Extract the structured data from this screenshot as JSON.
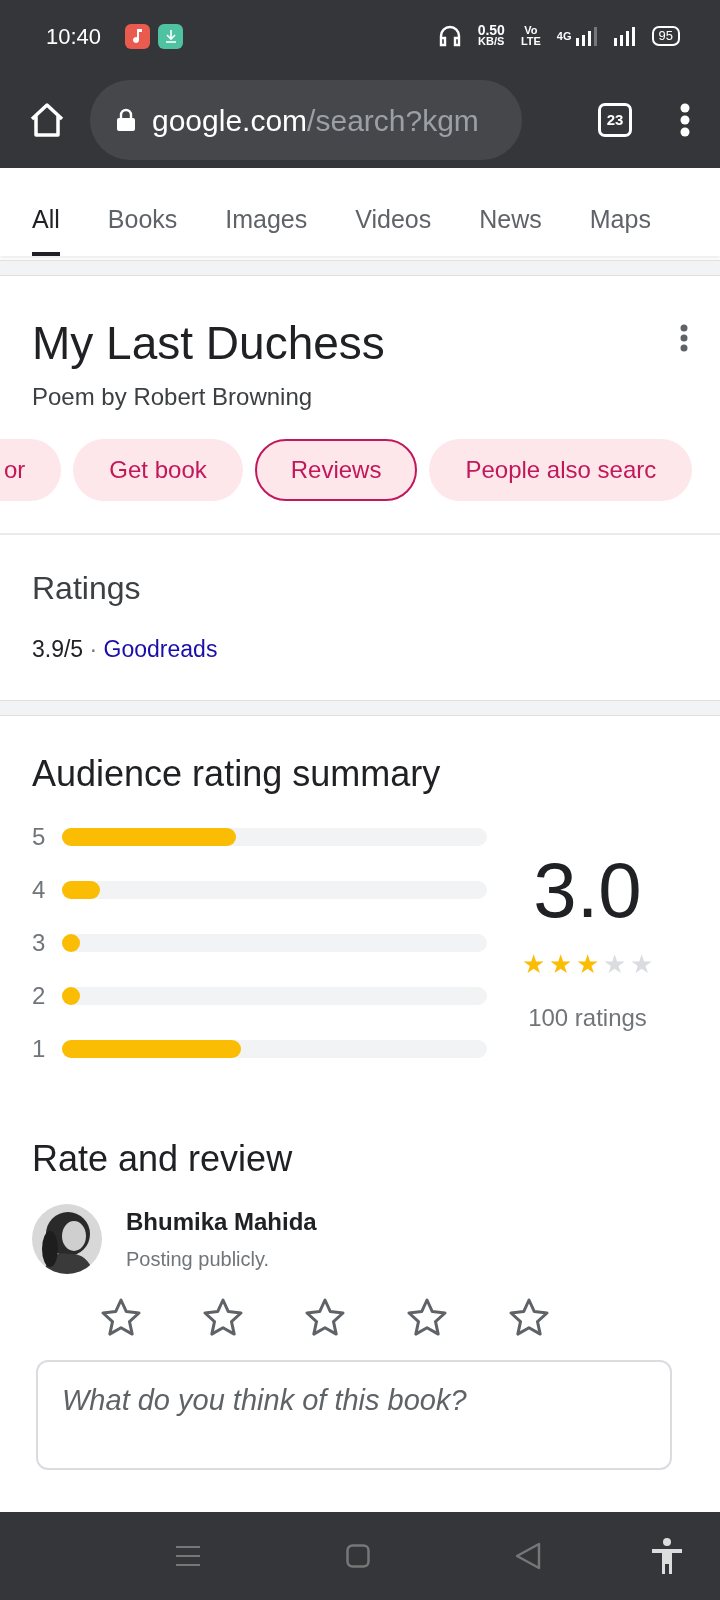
{
  "status_bar": {
    "time": "10:40",
    "speed_value": "0.50",
    "speed_unit": "KB/S",
    "volte_top": "Vo",
    "volte_bottom": "LTE",
    "network": "4G",
    "battery": "95"
  },
  "browser": {
    "url_host": "google.com",
    "url_path": "/search?kgm",
    "tab_count": "23"
  },
  "search_tabs": [
    {
      "label": "All",
      "selected": true
    },
    {
      "label": "Books",
      "selected": false
    },
    {
      "label": "Images",
      "selected": false
    },
    {
      "label": "Videos",
      "selected": false
    },
    {
      "label": "News",
      "selected": false
    },
    {
      "label": "Maps",
      "selected": false
    }
  ],
  "entity": {
    "title": "My Last Duchess",
    "subtitle": "Poem by Robert Browning",
    "chips": [
      {
        "label": "or",
        "selected": false
      },
      {
        "label": "Get book",
        "selected": false
      },
      {
        "label": "Reviews",
        "selected": true
      },
      {
        "label": "People also searc",
        "selected": false
      }
    ]
  },
  "ratings": {
    "heading": "Ratings",
    "score": "3.9/5",
    "separator": "·",
    "source": "Goodreads"
  },
  "audience": {
    "heading": "Audience rating summary",
    "bars": [
      {
        "label": "5",
        "level": 0.41
      },
      {
        "label": "4",
        "level": 0.09
      },
      {
        "label": "3",
        "level": 0.04
      },
      {
        "label": "2",
        "level": 0.04
      },
      {
        "label": "1",
        "level": 0.42
      }
    ],
    "average": "3.0",
    "stars": 3,
    "count": "100 ratings"
  },
  "review": {
    "heading": "Rate and review",
    "user": "Bhumika Mahida",
    "visibility": "Posting publicly.",
    "stars": 0,
    "placeholder": "What do you think of this book?"
  }
}
